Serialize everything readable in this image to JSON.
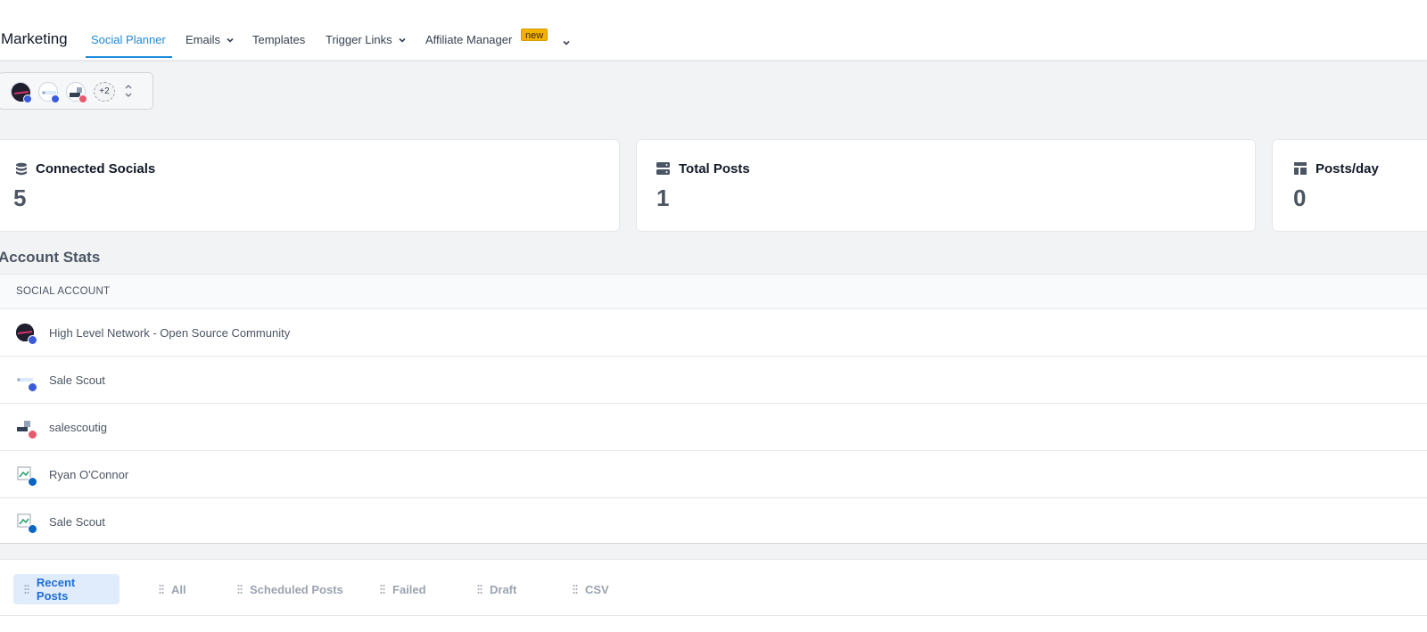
{
  "nav": {
    "brand": "Marketing",
    "items": [
      {
        "label": "Social Planner",
        "active": true
      },
      {
        "label": "Emails",
        "dropdown": true
      },
      {
        "label": "Templates"
      },
      {
        "label": "Trigger Links",
        "dropdown": true
      },
      {
        "label": "Affiliate Manager"
      }
    ],
    "new_badge": "new"
  },
  "account_selector": {
    "extra_count": "+2"
  },
  "stats": {
    "connected": {
      "title": "Connected Socials",
      "value": "5"
    },
    "total_posts": {
      "title": "Total Posts",
      "value": "1"
    },
    "posts_per_day": {
      "title": "Posts/day",
      "value": "0"
    }
  },
  "account_stats": {
    "title": "Account Stats",
    "column_header": "SOCIAL ACCOUNT",
    "rows": [
      {
        "name": "High Level Network - Open Source Community",
        "network": "facebook"
      },
      {
        "name": "Sale Scout",
        "network": "facebook"
      },
      {
        "name": "salescoutig",
        "network": "instagram"
      },
      {
        "name": "Ryan O'Connor",
        "network": "linkedin"
      },
      {
        "name": "Sale Scout",
        "network": "linkedin"
      }
    ]
  },
  "tabs": [
    "Recent Posts",
    "All",
    "Scheduled Posts",
    "Failed",
    "Draft",
    "CSV"
  ],
  "colors": {
    "accent": "#1d8ad6",
    "facebook": "#3b5bdb",
    "instagram": "#e8596e",
    "linkedin": "#0a66c2",
    "badge": "#f5b100"
  }
}
